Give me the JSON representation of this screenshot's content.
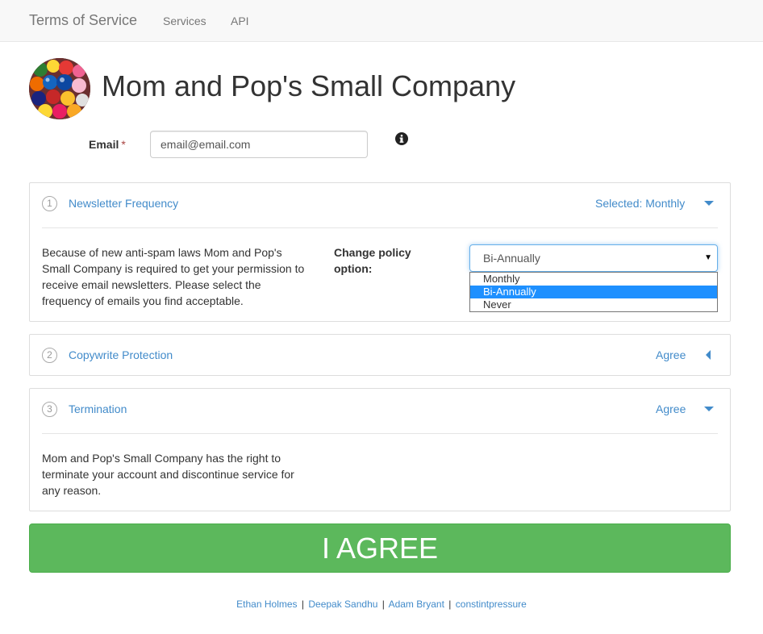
{
  "navbar": {
    "brand": "Terms of Service",
    "links": [
      "Services",
      "API"
    ]
  },
  "company": {
    "name": "Mom and Pop's Small Company",
    "logo_icon": "gumball-logo"
  },
  "email": {
    "label": "Email",
    "required_mark": "*",
    "value": "email@email.com",
    "info_icon": "info-icon"
  },
  "sections": [
    {
      "number": "1",
      "title": "Newsletter Frequency",
      "status": "Selected: Monthly",
      "expanded": true,
      "body": "Because of new anti-spam laws Mom and Pop's Small Company is required to get your permission to receive email newsletters. Please select the frequency of emails you find acceptable.",
      "policy_label": "Change policy option:",
      "select_value": "Bi-Annually",
      "options": [
        "Monthly",
        "Bi-Annually",
        "Never"
      ],
      "highlighted_option": "Bi-Annually"
    },
    {
      "number": "2",
      "title": "Copywrite Protection",
      "status": "Agree",
      "expanded": false
    },
    {
      "number": "3",
      "title": "Termination",
      "status": "Agree",
      "expanded": true,
      "body": "Mom and Pop's Small Company has the right to terminate your account and discontinue service for any reason."
    }
  ],
  "agree_button": "I AGREE",
  "footer": {
    "authors": [
      "Ethan Holmes",
      "Deepak Sandhu",
      "Adam Bryant",
      "constintpressure"
    ],
    "separator": "|"
  },
  "colors": {
    "link": "#428bca",
    "button": "#5cb85c",
    "highlight": "#1e90ff"
  }
}
